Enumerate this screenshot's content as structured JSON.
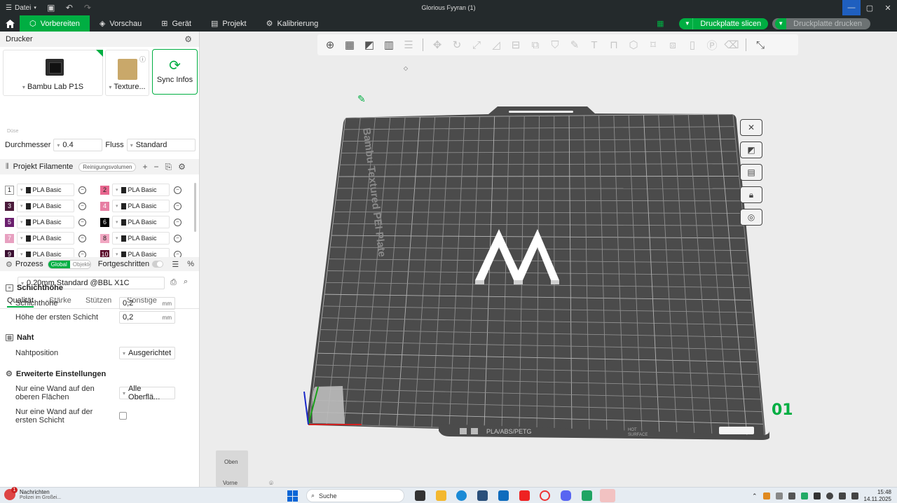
{
  "titlebar": {
    "file_label": "Datei",
    "window_title": "Glorious Fyyran (1)"
  },
  "nav": {
    "tabs": [
      {
        "label": "Vorbereiten",
        "icon": "cube-icon"
      },
      {
        "label": "Vorschau",
        "icon": "layers-icon"
      },
      {
        "label": "Gerät",
        "icon": "device-icon"
      },
      {
        "label": "Projekt",
        "icon": "project-icon"
      },
      {
        "label": "Kalibrierung",
        "icon": "calibration-icon"
      }
    ],
    "slice_label": "Druckplatte slicen",
    "print_label": "Druckplatte drucken"
  },
  "printer": {
    "section_title": "Drucker",
    "printer_name": "Bambu Lab P1S",
    "plate_name": "Texture...",
    "sync_label": "Sync Infos",
    "nozzle_section": "Düse",
    "diameter_label": "Durchmesser",
    "diameter_value": "0.4",
    "flow_label": "Fluss",
    "flow_value": "Standard"
  },
  "filaments": {
    "section_title": "Projekt Filamente",
    "purge_label": "Reinigungsvolumen",
    "items": [
      {
        "num": "1",
        "name": "PLA Basic",
        "color": "#ffffff",
        "text": "#222222"
      },
      {
        "num": "2",
        "name": "PLA Basic",
        "color": "#e8678f",
        "text": "#222222"
      },
      {
        "num": "3",
        "name": "PLA Basic",
        "color": "#4a1a3a",
        "text": "#ffffff"
      },
      {
        "num": "4",
        "name": "PLA Basic",
        "color": "#e77fa3",
        "text": "#ffffff"
      },
      {
        "num": "5",
        "name": "PLA Basic",
        "color": "#6b1f6e",
        "text": "#ffffff"
      },
      {
        "num": "6",
        "name": "PLA Basic",
        "color": "#000000",
        "text": "#ffffff"
      },
      {
        "num": "7",
        "name": "PLA Basic",
        "color": "#e7a0c0",
        "text": "#ffffff"
      },
      {
        "num": "8",
        "name": "PLA Basic",
        "color": "#f1a7c2",
        "text": "#222222"
      },
      {
        "num": "9",
        "name": "PLA Basic",
        "color": "#3a0e30",
        "text": "#ffffff"
      },
      {
        "num": "10",
        "name": "PLA Basic",
        "color": "#5a0a2a",
        "text": "#ffffff"
      }
    ]
  },
  "process": {
    "section_title": "Prozess",
    "toggle_global": "Global",
    "toggle_objects": "Objekte",
    "advanced_label": "Fortgeschritten",
    "profile": "0.20mm Standard @BBL X1C",
    "tabs": [
      "Qualität",
      "Stärke",
      "Stützen",
      "Sonstige"
    ],
    "group_layer": "Schichthöhe",
    "layer_height_label": "Schichthöhe",
    "layer_height_value": "0,2",
    "first_layer_label": "Höhe der ersten Schicht",
    "first_layer_value": "0,2",
    "unit_mm": "mm",
    "group_seam": "Naht",
    "seam_label": "Nahtposition",
    "seam_value": "Ausgerichtet",
    "group_advanced": "Erweiterte Einstellungen",
    "one_wall_top_label": "Nur eine Wand auf den oberen Flächen",
    "one_wall_top_value": "Alle Oberflä...",
    "one_wall_first_label": "Nur eine Wand auf der ersten Schicht"
  },
  "plate": {
    "label": "Bambu Textured PEI Plate",
    "plate_number": "01",
    "footer_text": "PLA/ABS/PETG",
    "hot_label": "HOT",
    "surface_label": "SURFACE"
  },
  "navcube": {
    "top": "Oben",
    "front": "Vorne"
  },
  "taskbar": {
    "notif_title": "Nachrichten",
    "notif_sub": "Polizei im Großei...",
    "notif_count": "1",
    "search_placeholder": "Suche",
    "time": "15:48",
    "date": "14.11.2025"
  },
  "colors": {
    "accent": "#00ae42",
    "dark_bar": "#242a2c",
    "plate": "#4b4b4b"
  }
}
